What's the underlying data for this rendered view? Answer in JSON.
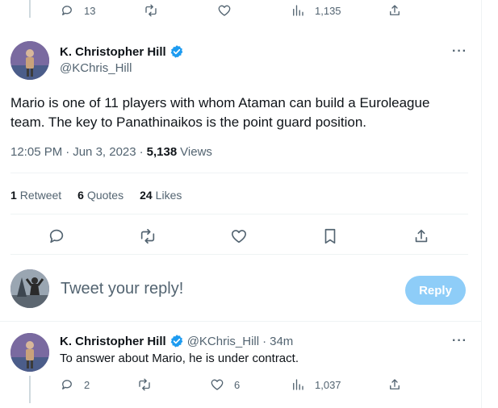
{
  "top_actions": {
    "replies": "13",
    "views": "1,135"
  },
  "tweet": {
    "author": {
      "display_name": "K. Christopher Hill",
      "handle": "@KChris_Hill",
      "verified": true
    },
    "text": "Mario is one of 11 players with whom Ataman can build a Euroleague team. The key to Panathinaikos is the point guard position.",
    "time": "12:05 PM",
    "date": "Jun 3, 2023",
    "views_count": "5,138",
    "views_label": "Views",
    "stats": {
      "retweets": {
        "count": "1",
        "label": "Retweet"
      },
      "quotes": {
        "count": "6",
        "label": "Quotes"
      },
      "likes": {
        "count": "24",
        "label": "Likes"
      }
    }
  },
  "composer": {
    "placeholder": "Tweet your reply!",
    "button_label": "Reply"
  },
  "reply": {
    "author": {
      "display_name": "K. Christopher Hill",
      "handle": "@KChris_Hill",
      "time": "34m"
    },
    "text": "To answer about Mario, he is under contract.",
    "actions": {
      "replies": "2",
      "likes": "6",
      "views": "1,037"
    }
  },
  "colors": {
    "accent": "#1d9bf0",
    "reply_button": "#8ecdf8",
    "secondary_text": "#536471",
    "primary_text": "#0f1419",
    "divider": "#eff3f4"
  },
  "icons": [
    "reply-icon",
    "retweet-icon",
    "like-icon",
    "views-icon",
    "share-icon",
    "bookmark-icon",
    "verified-icon",
    "more-icon"
  ]
}
